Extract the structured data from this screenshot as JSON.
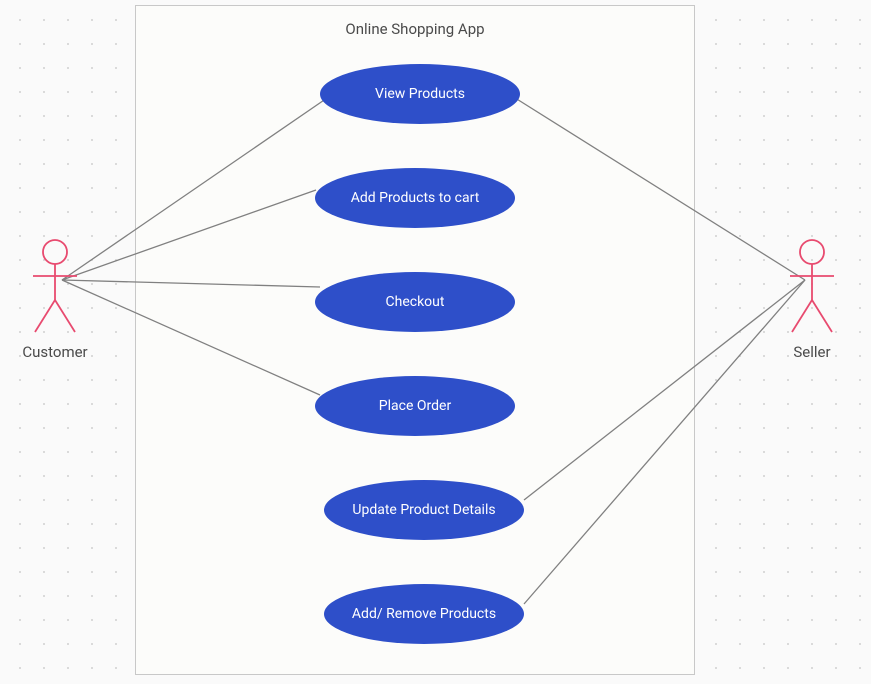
{
  "system": {
    "title": "Online Shopping App"
  },
  "actors": {
    "customer": {
      "label": "Customer"
    },
    "seller": {
      "label": "Seller"
    }
  },
  "use_cases": {
    "view_products": {
      "label": "View Products"
    },
    "add_to_cart": {
      "label": "Add Products to cart"
    },
    "checkout": {
      "label": "Checkout"
    },
    "place_order": {
      "label": "Place Order"
    },
    "update_product": {
      "label": "Update Product Details"
    },
    "add_remove_products": {
      "label": "Add/ Remove Products"
    }
  }
}
